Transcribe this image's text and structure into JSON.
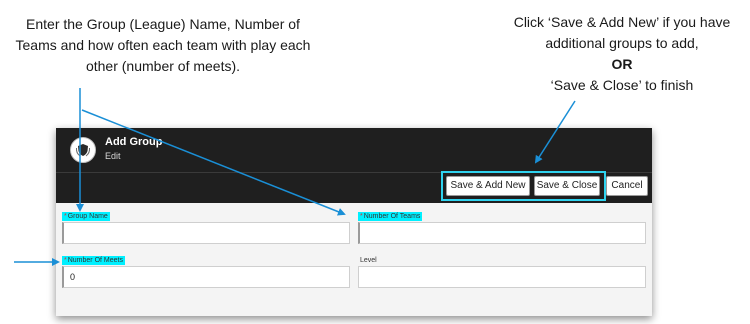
{
  "annotations": {
    "left_text": "Enter the Group (League) Name, Number of Teams and how often each team with play each other (number of meets).",
    "right_line1": "Click ‘Save & Add New’ if you have additional groups to add,",
    "right_or": "OR",
    "right_line2": "‘Save & Close’ to finish"
  },
  "header": {
    "title": "Add Group",
    "subtitle": "Edit",
    "logo_icon": "shield-laurel-logo"
  },
  "toolbar": {
    "save_add_new_label": "Save & Add New",
    "save_close_label": "Save & Close",
    "cancel_label": "Cancel"
  },
  "form": {
    "group_name": {
      "label": "Group Name",
      "value": ""
    },
    "number_of_teams": {
      "label": "Number Of Teams",
      "value": ""
    },
    "number_of_meets": {
      "label": "Number Of Meets",
      "value": "0"
    },
    "level": {
      "label": "Level",
      "value": ""
    }
  },
  "colors": {
    "highlight": "#00f0ff",
    "arrow": "#1a8fd6",
    "header_bg": "#1f1f1f"
  }
}
